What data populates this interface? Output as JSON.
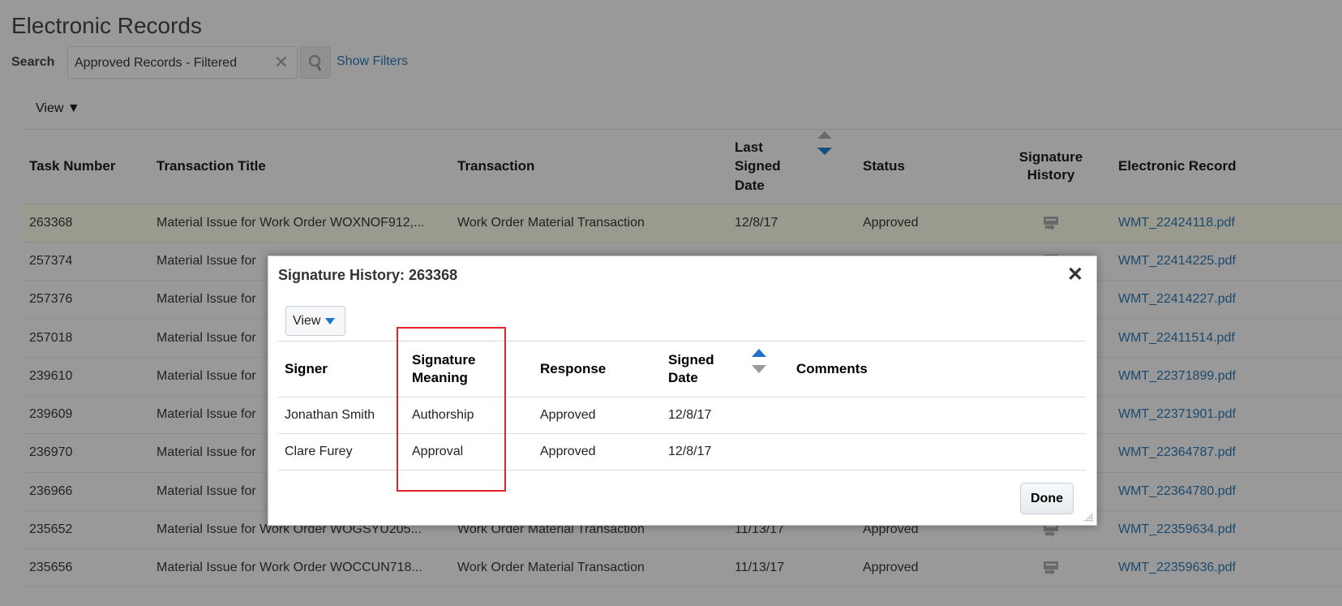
{
  "page": {
    "title": "Electronic Records"
  },
  "search": {
    "label": "Search",
    "value": "Approved Records - Filtered",
    "show_filters": "Show Filters"
  },
  "toolbar": {
    "view": "View"
  },
  "table": {
    "headers": [
      "Task Number",
      "Transaction Title",
      "Transaction",
      "Last Signed Date",
      "Status",
      "Signature History",
      "Electronic Record"
    ],
    "sort": "Last Signed Date descending",
    "rows": [
      {
        "task": "263368",
        "title": "Material Issue for Work Order WOXNOF912,...",
        "transaction": "Work Order Material Transaction",
        "date": "12/8/17",
        "status": "Approved",
        "record": "WMT_22424118.pdf",
        "selected": true
      },
      {
        "task": "257374",
        "title": "Material Issue for",
        "transaction": "",
        "date": "",
        "status": "",
        "record": "WMT_22414225.pdf"
      },
      {
        "task": "257376",
        "title": "Material Issue for",
        "transaction": "",
        "date": "",
        "status": "",
        "record": "WMT_22414227.pdf"
      },
      {
        "task": "257018",
        "title": "Material Issue for",
        "transaction": "",
        "date": "",
        "status": "",
        "record": "WMT_22411514.pdf"
      },
      {
        "task": "239610",
        "title": "Material Issue for",
        "transaction": "",
        "date": "",
        "status": "",
        "record": "WMT_22371899.pdf"
      },
      {
        "task": "239609",
        "title": "Material Issue for",
        "transaction": "",
        "date": "",
        "status": "",
        "record": "WMT_22371901.pdf"
      },
      {
        "task": "236970",
        "title": "Material Issue for",
        "transaction": "",
        "date": "",
        "status": "",
        "record": "WMT_22364787.pdf"
      },
      {
        "task": "236966",
        "title": "Material Issue for",
        "transaction": "",
        "date": "",
        "status": "",
        "record": "WMT_22364780.pdf"
      },
      {
        "task": "235652",
        "title": "Material Issue for Work Order WOGSYU205...",
        "transaction": "Work Order Material Transaction",
        "date": "11/13/17",
        "status": "Approved",
        "record": "WMT_22359634.pdf"
      },
      {
        "task": "235656",
        "title": "Material Issue for Work Order WOCCUN718...",
        "transaction": "Work Order Material Transaction",
        "date": "11/13/17",
        "status": "Approved",
        "record": "WMT_22359636.pdf"
      }
    ]
  },
  "dialog": {
    "title": "Signature History: 263368",
    "view": "View",
    "headers": [
      "Signer",
      "Signature Meaning",
      "Response",
      "Signed Date",
      "Comments"
    ],
    "rows": [
      {
        "signer": "Jonathan Smith",
        "meaning": "Authorship",
        "response": "Approved",
        "date": "12/8/17",
        "comments": ""
      },
      {
        "signer": "Clare Furey",
        "meaning": "Approval",
        "response": "Approved",
        "date": "12/8/17",
        "comments": ""
      }
    ],
    "done": "Done",
    "accent_color": "#1e74c8",
    "highlight_color": "#e8202a"
  }
}
